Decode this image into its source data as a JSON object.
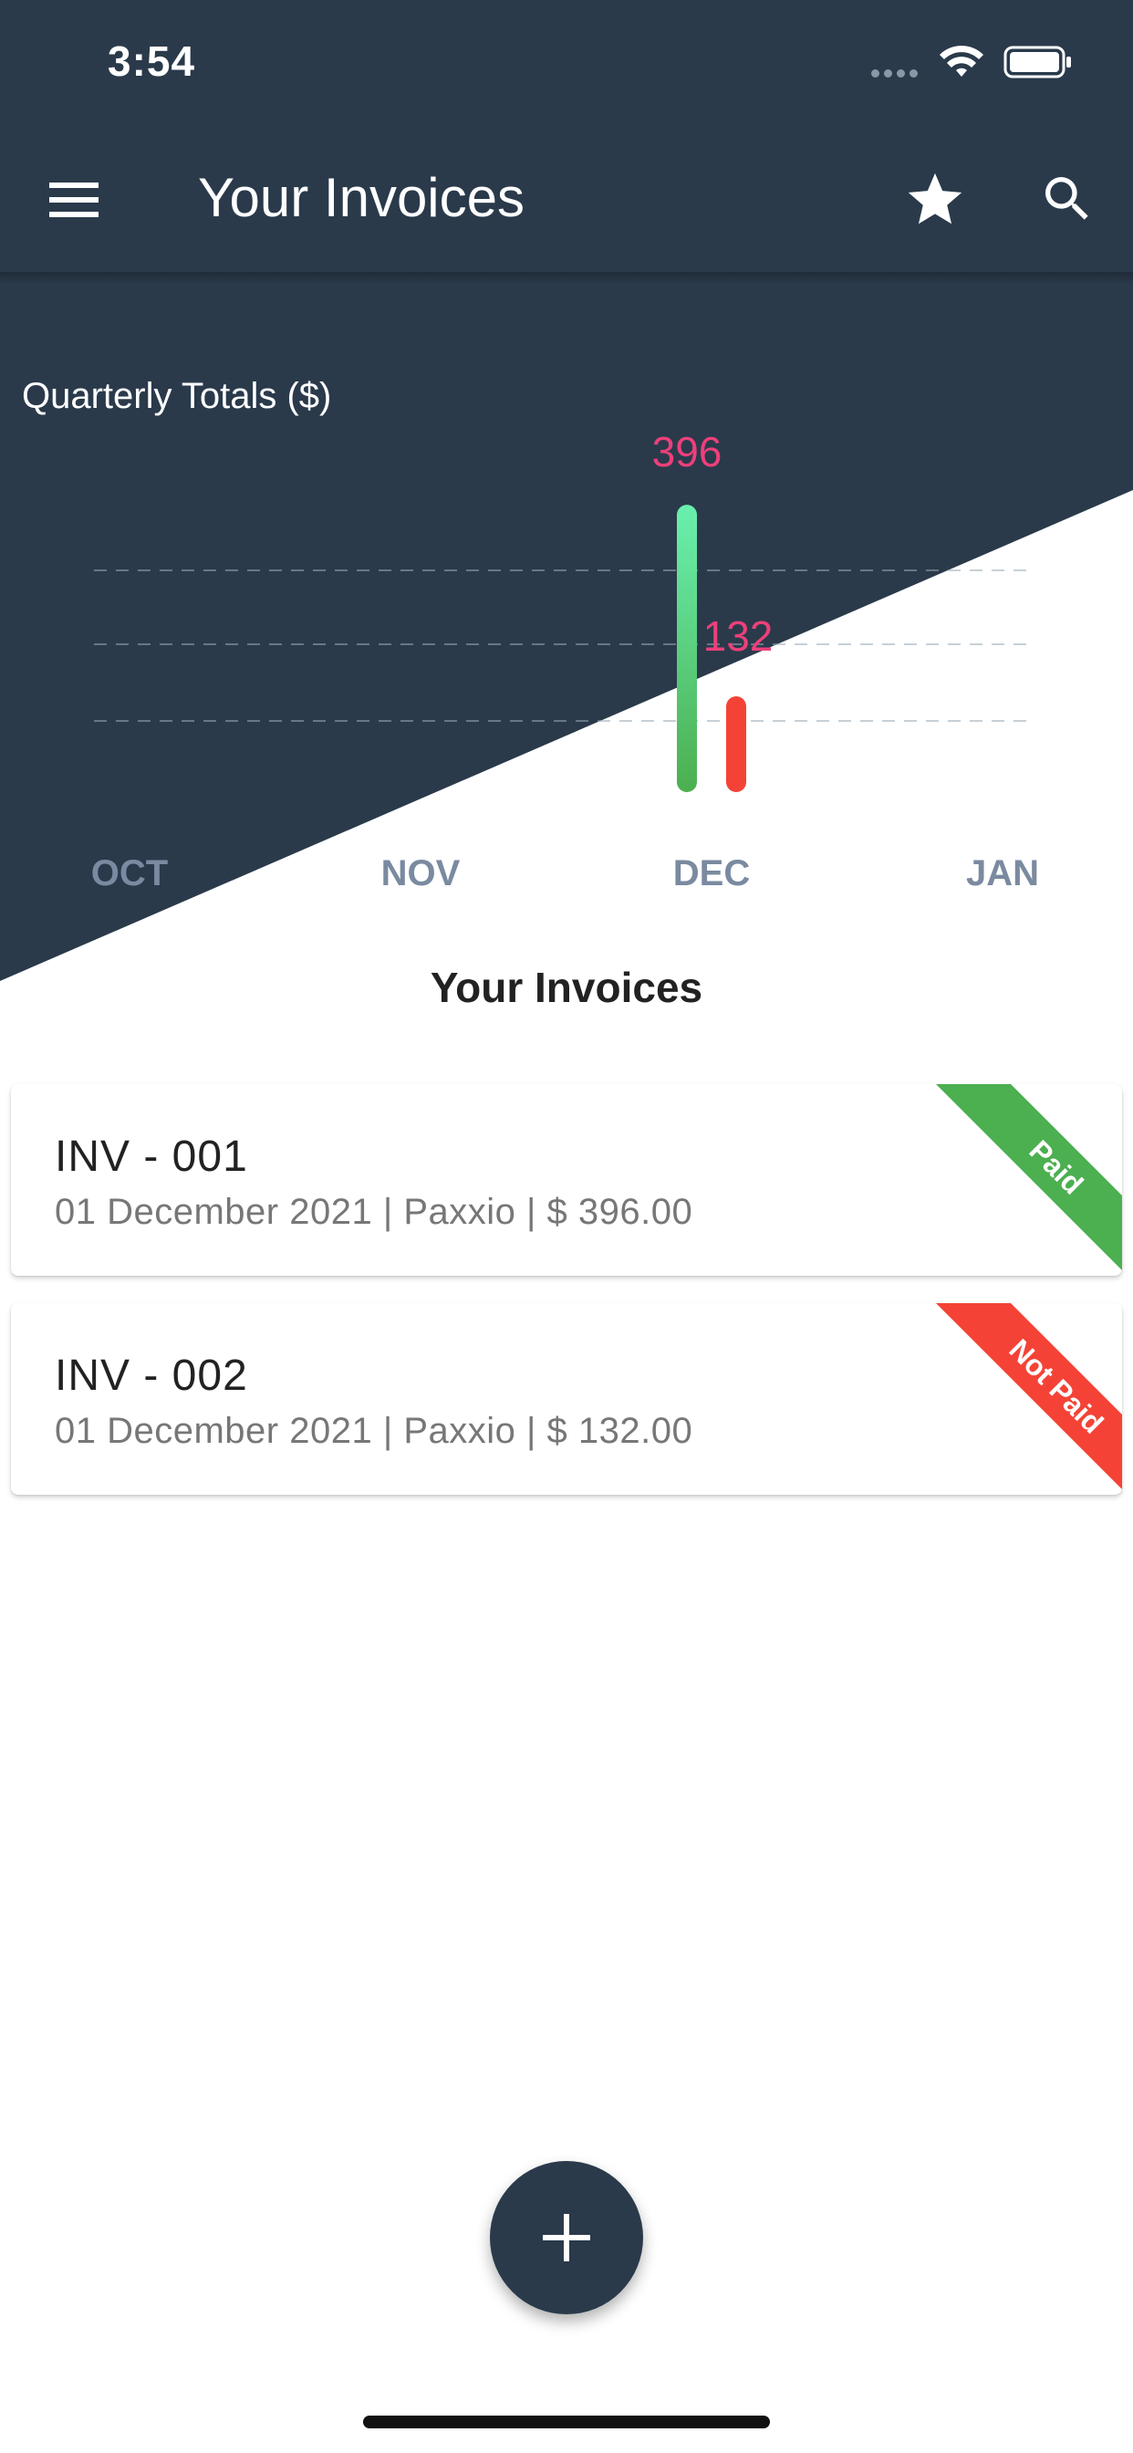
{
  "status_bar": {
    "time": "3:54"
  },
  "app_bar": {
    "title": "Your Invoices",
    "icons": [
      "menu-icon",
      "star-icon",
      "search-icon"
    ]
  },
  "chart_data": {
    "type": "bar",
    "title": "Quarterly Totals ($)",
    "categories": [
      "OCT",
      "NOV",
      "DEC",
      "JAN"
    ],
    "series": [
      {
        "values": [
          0,
          0,
          396,
          0
        ],
        "color": "#4caf50",
        "color_top": "#69f0ae"
      },
      {
        "values": [
          0,
          0,
          132,
          0
        ],
        "color": "#f44336"
      }
    ],
    "data_labels": [
      "396",
      "132"
    ],
    "ylim": [
      0,
      400
    ],
    "grid": true,
    "label_color": "#ec407a",
    "axis_label_color": "#7a8aa0"
  },
  "section": {
    "title": "Your Invoices"
  },
  "invoices": [
    {
      "id": "INV - 001",
      "details": "01 December 2021 | Paxxio | $ 396.00",
      "status": "Paid",
      "status_color": "#4caf50"
    },
    {
      "id": "INV - 002",
      "details": "01 December 2021 | Paxxio | $ 132.00",
      "status": "Not Paid",
      "status_color": "#f44336"
    }
  ],
  "fab": {
    "icon": "plus-icon"
  },
  "colors": {
    "primary": "#2a3a4b",
    "background": "#ffffff"
  }
}
